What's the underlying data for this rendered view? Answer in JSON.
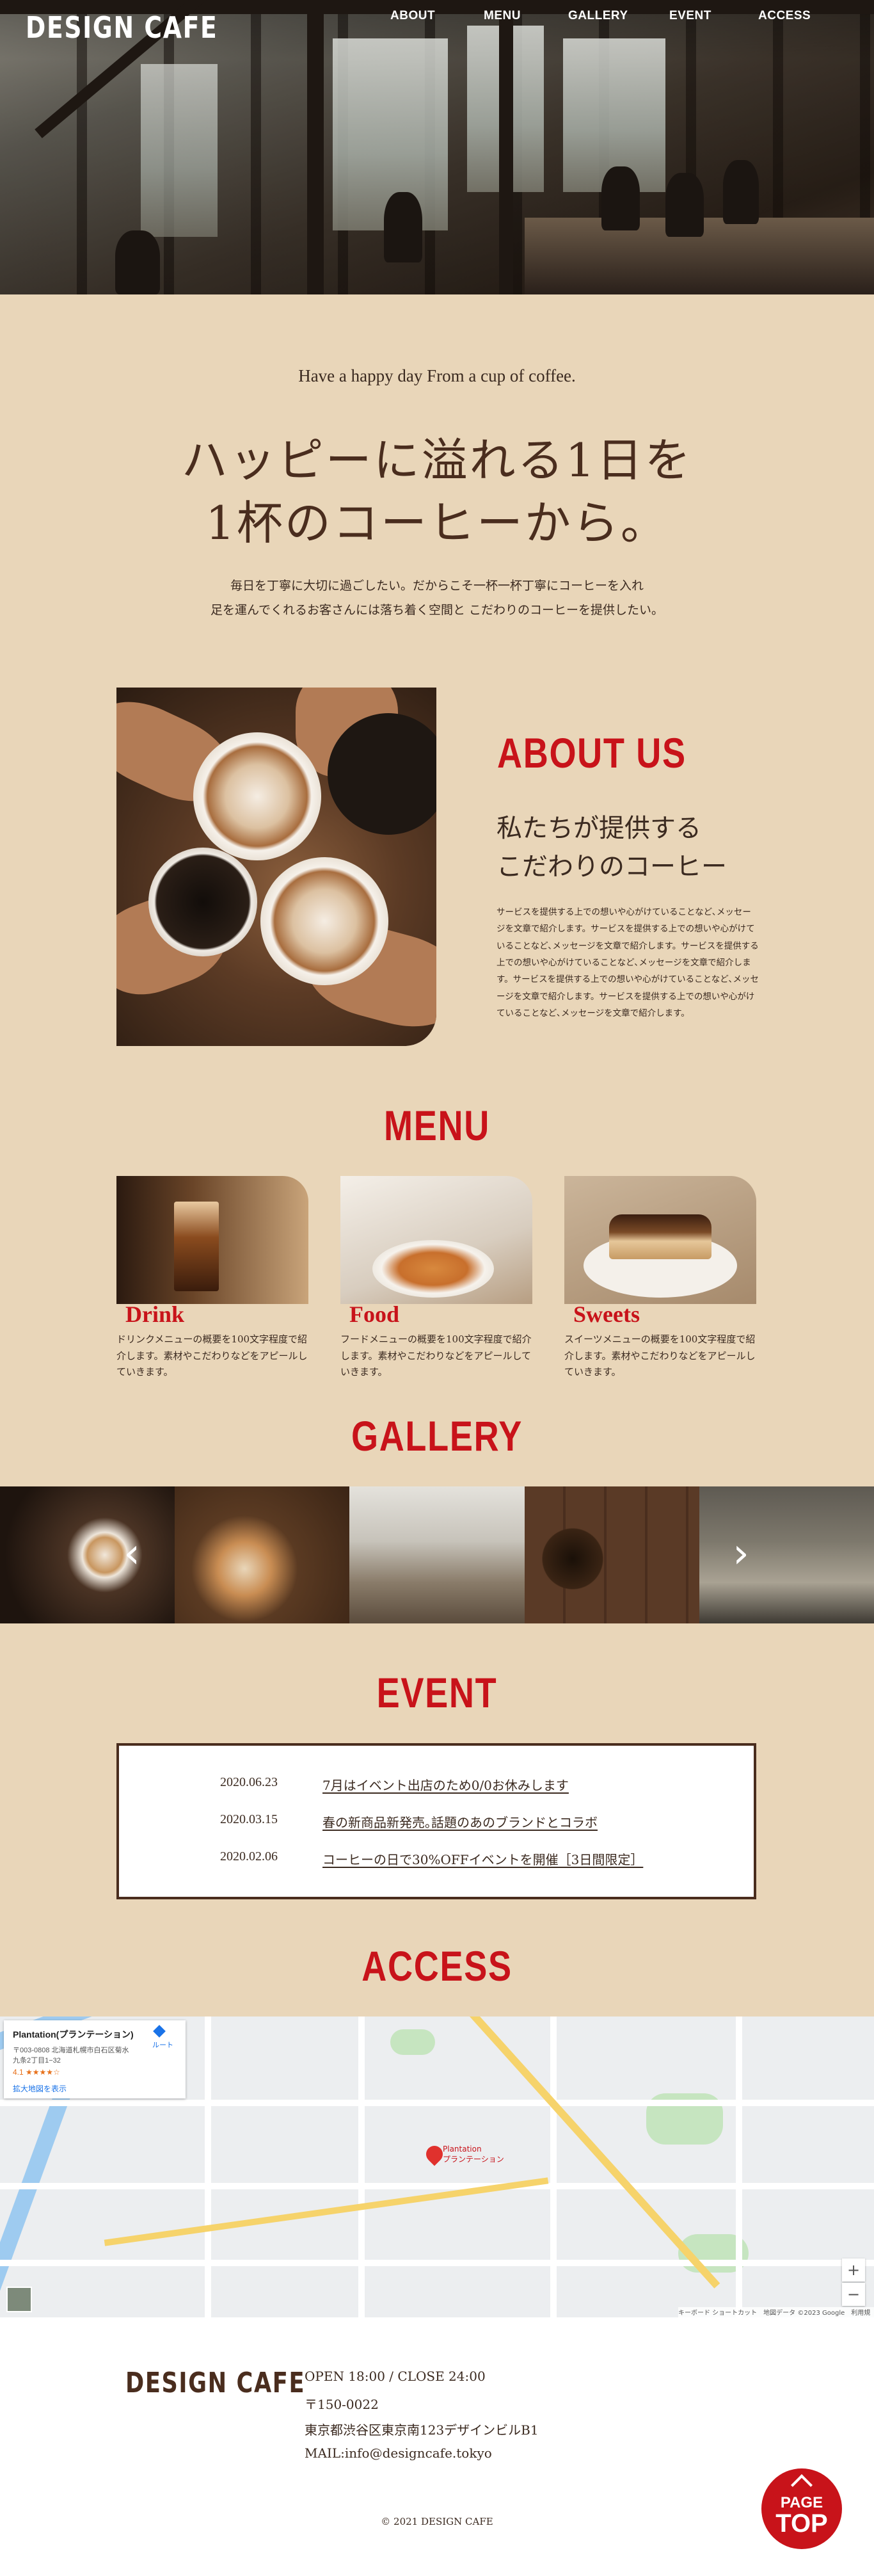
{
  "header": {
    "logo": "DESIGN CAFE",
    "nav": [
      "ABOUT",
      "MENU",
      "GALLERY",
      "EVENT",
      "ACCESS"
    ]
  },
  "intro": {
    "tagline": "Have a happy day From a cup of coffee.",
    "headline_line1": "ハッピーに溢れる1日を",
    "headline_line2": "1杯のコーヒーから。",
    "lead_line1": "毎日を丁寧に大切に過ごしたい。だからこそ一杯一杯丁寧にコーヒーを入れ",
    "lead_line2": "足を運んでくれるお客さんには落ち着く空間と こだわりのコーヒーを提供したい。"
  },
  "about": {
    "title": "ABOUT US",
    "subtitle_line1": "私たちが提供する",
    "subtitle_line2": "こだわりのコーヒー",
    "body": "サービスを提供する上での想いや心がけていることなど､メッセージを文章で紹介します。サービスを提供する上での想いや心がけていることなど､メッセージを文章で紹介します。サービスを提供する上での想いや心がけていることなど､メッセージを文章で紹介します。サービスを提供する上での想いや心がけていることなど､メッセージを文章で紹介します。サービスを提供する上での想いや心がけていることなど､メッセージを文章で紹介します。"
  },
  "menu": {
    "title": "MENU",
    "items": [
      {
        "label": "Drink",
        "desc": "ドリンクメニューの概要を100文字程度で紹介します。素材やこだわりなどをアピールしていきます。"
      },
      {
        "label": "Food",
        "desc": "フードメニューの概要を100文字程度で紹介します。素材やこだわりなどをアピールしていきます。"
      },
      {
        "label": "Sweets",
        "desc": "スイーツメニューの概要を100文字程度で紹介します。素材やこだわりなどをアピールしていきます。"
      }
    ]
  },
  "gallery": {
    "title": "GALLERY",
    "prev": "‹",
    "next": "›"
  },
  "event": {
    "title": "EVENT",
    "items": [
      {
        "date": "2020.06.23",
        "text": "7月はイベント出店のため0/0お休みします"
      },
      {
        "date": "2020.03.15",
        "text": "春の新商品新発売｡話題のあのブランドとコラボ"
      },
      {
        "date": "2020.02.06",
        "text": "コーヒーの日で30%OFFイベントを開催［3日間限定］"
      }
    ]
  },
  "access": {
    "title": "ACCESS",
    "map_card": {
      "name": "Plantation(プランテーション)",
      "address_line1": "〒003-0808 北海道札幌市白石区菊水",
      "address_line2": "九条2丁目1−32",
      "rating": "4.1 ★★★★☆",
      "larger_map": "拡大地図を表示",
      "route": "ルート"
    },
    "pin_label": "Plantation\nプランテーション",
    "attribution": "キーボード ショートカット　地図データ ©2023 Google　利用規約",
    "zoom_in": "+",
    "zoom_out": "−"
  },
  "footer": {
    "logo": "DESIGN CAFE",
    "hours": "OPEN 18:00 / CLOSE 24:00",
    "postal": "〒150-0022",
    "address": "東京都渋谷区東京南123デザインビルB1",
    "mail": "MAIL:info@designcafe.tokyo",
    "copyright": "© 2021 DESIGN CAFE",
    "pagetop_line1": "PAGE",
    "pagetop_line2": "TOP"
  },
  "colors": {
    "background": "#e9d6b9",
    "accent_red": "#c8131a",
    "brown": "#4a2d1e"
  }
}
